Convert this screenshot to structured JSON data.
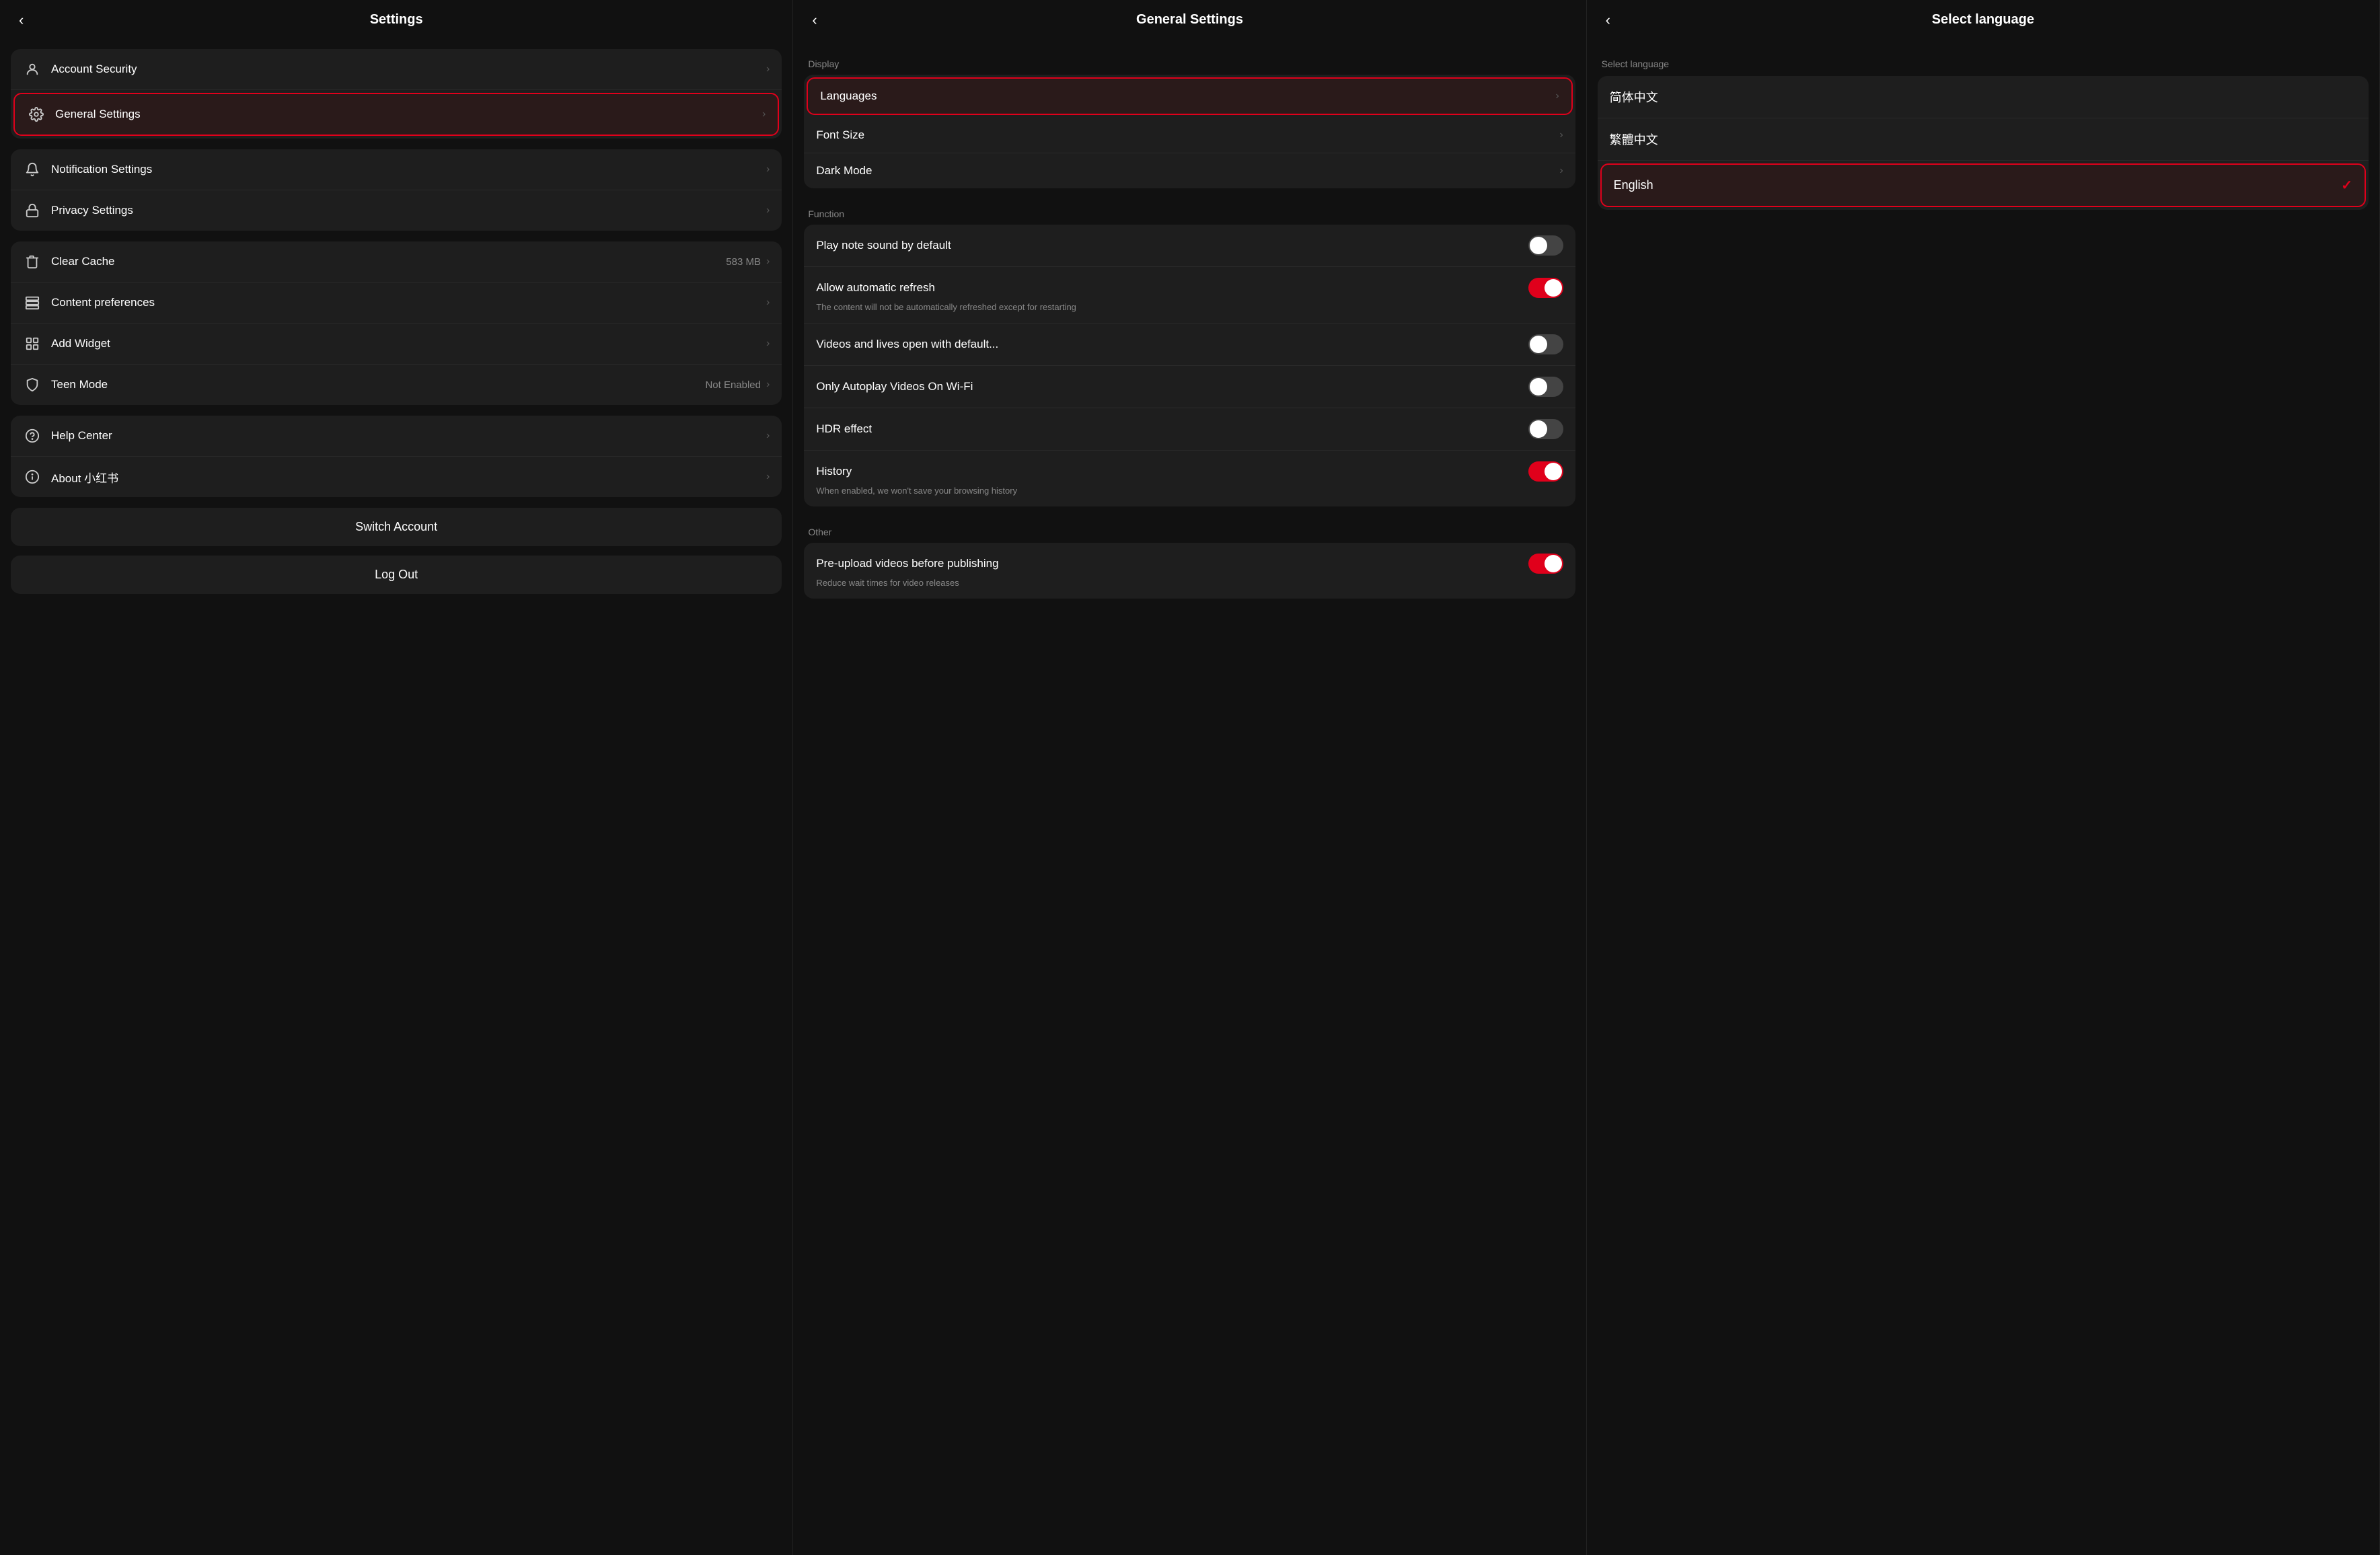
{
  "panel1": {
    "title": "Settings",
    "back_label": "‹",
    "groups": [
      {
        "id": "group-account",
        "highlighted": false,
        "items": [
          {
            "id": "account-security",
            "icon": "person",
            "label": "Account Security",
            "value": "",
            "chevron": true
          },
          {
            "id": "general-settings",
            "icon": "gear",
            "label": "General Settings",
            "value": "",
            "chevron": true,
            "highlighted": true
          }
        ]
      },
      {
        "id": "group-notify",
        "highlighted": false,
        "items": [
          {
            "id": "notification-settings",
            "icon": "bell",
            "label": "Notification Settings",
            "value": "",
            "chevron": true
          },
          {
            "id": "privacy-settings",
            "icon": "lock",
            "label": "Privacy Settings",
            "value": "",
            "chevron": true
          }
        ]
      },
      {
        "id": "group-tools",
        "highlighted": false,
        "items": [
          {
            "id": "clear-cache",
            "icon": "trash",
            "label": "Clear Cache",
            "value": "583 MB",
            "chevron": true
          },
          {
            "id": "content-preferences",
            "icon": "layers",
            "label": "Content preferences",
            "value": "",
            "chevron": true
          },
          {
            "id": "add-widget",
            "icon": "widget",
            "label": "Add Widget",
            "value": "",
            "chevron": true
          },
          {
            "id": "teen-mode",
            "icon": "shield",
            "label": "Teen Mode",
            "value": "Not Enabled",
            "chevron": true
          }
        ]
      },
      {
        "id": "group-help",
        "highlighted": false,
        "items": [
          {
            "id": "help-center",
            "icon": "help",
            "label": "Help Center",
            "value": "",
            "chevron": true
          },
          {
            "id": "about",
            "icon": "info",
            "label": "About 小红书",
            "value": "",
            "chevron": true
          }
        ]
      }
    ],
    "switch_account": "Switch Account",
    "log_out": "Log Out"
  },
  "panel2": {
    "title": "General Settings",
    "back_label": "‹",
    "display_label": "Display",
    "function_label": "Function",
    "other_label": "Other",
    "display_items": [
      {
        "id": "languages",
        "label": "Languages",
        "chevron": true,
        "highlighted": true
      },
      {
        "id": "font-size",
        "label": "Font Size",
        "chevron": true
      },
      {
        "id": "dark-mode",
        "label": "Dark Mode",
        "chevron": true
      }
    ],
    "function_items": [
      {
        "id": "play-note-sound",
        "label": "Play note sound by default",
        "toggle": true,
        "on": false,
        "sub": ""
      },
      {
        "id": "allow-auto-refresh",
        "label": "Allow automatic refresh",
        "toggle": true,
        "on": true,
        "sub": "The content will not be automatically refreshed except for restarting"
      },
      {
        "id": "videos-lives",
        "label": "Videos and lives open with default...",
        "toggle": true,
        "on": false,
        "sub": ""
      },
      {
        "id": "autoplay-wifi",
        "label": "Only Autoplay Videos On Wi-Fi",
        "toggle": true,
        "on": false,
        "sub": ""
      },
      {
        "id": "hdr-effect",
        "label": "HDR effect",
        "toggle": true,
        "on": false,
        "sub": ""
      },
      {
        "id": "history",
        "label": "History",
        "toggle": true,
        "on": true,
        "sub": "When enabled,  we won't save your browsing history"
      }
    ],
    "other_items": [
      {
        "id": "pre-upload",
        "label": "Pre-upload videos before publishing",
        "toggle": true,
        "on": true,
        "sub": "Reduce wait times for video releases"
      }
    ]
  },
  "panel3": {
    "title": "Select language",
    "back_label": "‹",
    "section_label": "Select language",
    "languages": [
      {
        "id": "zh-cn",
        "label": "简体中文",
        "selected": false
      },
      {
        "id": "zh-tw",
        "label": "繁體中文",
        "selected": false
      },
      {
        "id": "en",
        "label": "English",
        "selected": true
      }
    ]
  }
}
